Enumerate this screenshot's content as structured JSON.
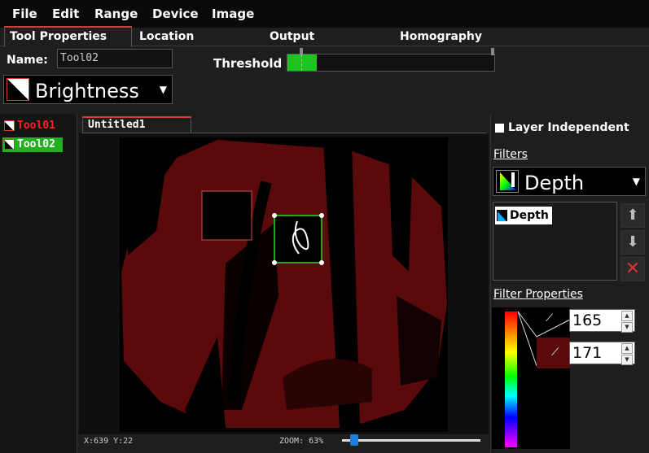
{
  "menu": {
    "items": [
      "File",
      "Edit",
      "Range",
      "Device",
      "Image"
    ]
  },
  "tabs": [
    "Tool Properties",
    "Location",
    "Output",
    "Homography"
  ],
  "properties": {
    "name_label": "Name:",
    "name_value": "Tool02",
    "tool_type": "Brightness",
    "threshold_label": "Threshold",
    "threshold_fill_fraction": 0.14
  },
  "tools": [
    {
      "label": "Tool01",
      "color": "#ff2020",
      "selected": false
    },
    {
      "label": "Tool02",
      "color": "#ffffff",
      "selected": true,
      "highlight": "#22b022"
    }
  ],
  "document": {
    "tab_label": "Untitled1",
    "status_coords": "X:639 Y:22",
    "zoom_label": "ZOOM: 63%"
  },
  "right": {
    "layer_independent_label": "Layer Independent",
    "filters_label": "Filters",
    "filter_type": "Depth",
    "filter_list": [
      "Depth"
    ],
    "filter_props_label": "Filter Properties",
    "value_min": "165",
    "value_max": "171"
  },
  "colors": {
    "accent": "#d83a3a",
    "green": "#1fc51f",
    "depth_red": "#5e0a0a"
  }
}
